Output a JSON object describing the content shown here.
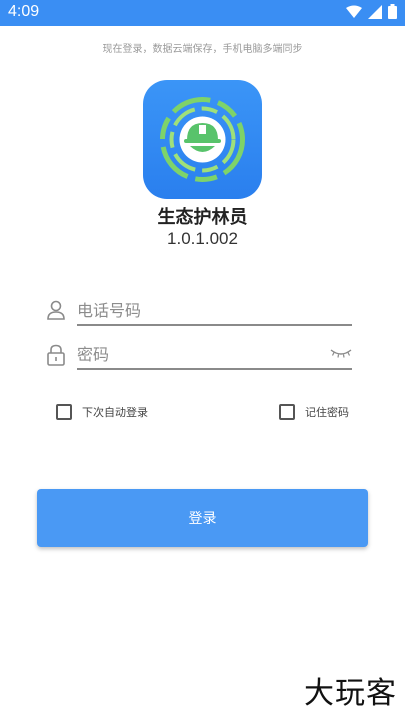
{
  "status_bar": {
    "time": "4:09",
    "icons": [
      "wifi-icon",
      "signal-icon",
      "battery-icon"
    ]
  },
  "tip": "现在登录，数据云端保存，手机电脑多端同步",
  "app": {
    "name": "生态护林员",
    "version": "1.0.1.002",
    "logo_icon": "ranger-helmet-icon"
  },
  "form": {
    "phone_placeholder": "电话号码",
    "password_placeholder": "密码",
    "auto_login_label": "下次自动登录",
    "remember_password_label": "记住密码",
    "login_button": "登录"
  },
  "watermark": "大玩客",
  "colors": {
    "primary": "#4a99f4",
    "status_bar": "#3a8ef3"
  }
}
